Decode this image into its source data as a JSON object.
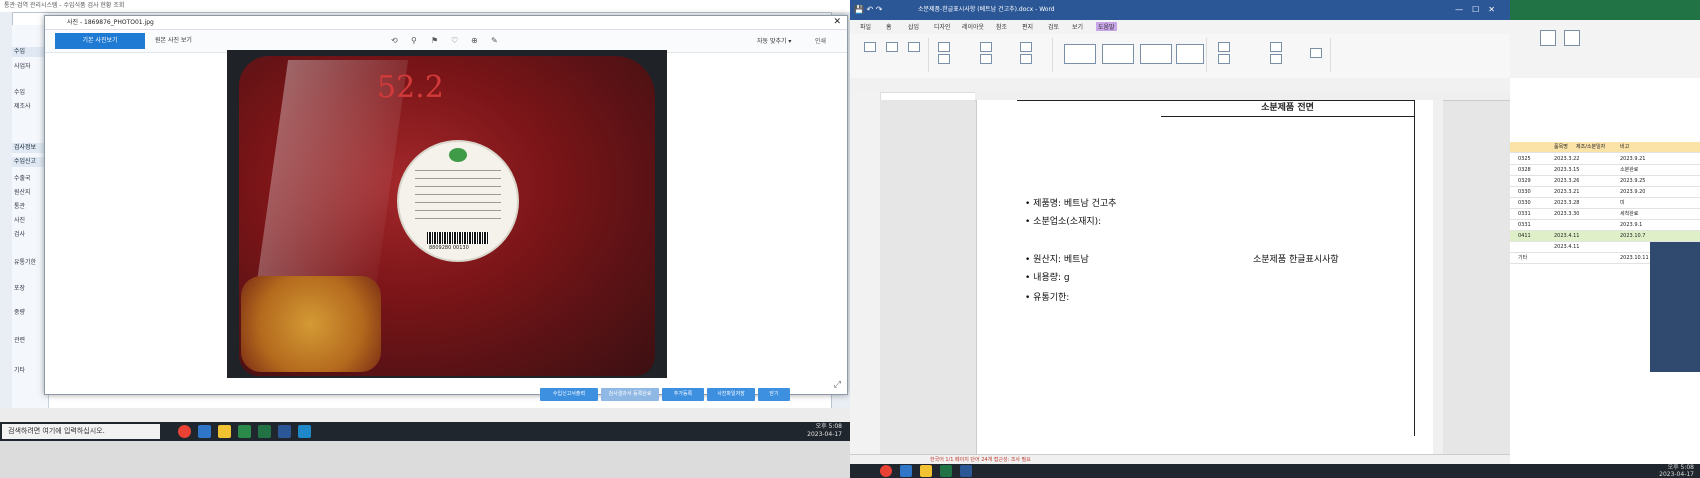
{
  "left_window": {
    "bg_title": "통관·검역 관리시스템 - 수입식품 검사 현황 조회",
    "viewer_title": "사진 - 1869876_PHOTO01.jpg",
    "tabs": [
      "기본 사진보기",
      "원본 사진 보기"
    ],
    "toolbar_icons": [
      "rotate-left-icon",
      "zoom-out-icon",
      "pin-icon",
      "heart-icon",
      "zoom-in-icon",
      "pencil-icon"
    ],
    "zoom_label": "자동 맞추기 ▾",
    "print_label": "인쇄",
    "sidebar": {
      "head1": "수입",
      "head2": "검사정보",
      "head3": "수입신고",
      "items": [
        "사업자",
        "수입",
        "제조사",
        "수출국",
        "원산지",
        "통관",
        "사진",
        "검사",
        "유통기한",
        "포장",
        "중량",
        "관련",
        "기타"
      ]
    },
    "actions": [
      "수입신고서출력",
      "검사결과서 등록완료",
      "추가등록",
      "사진파일저장",
      "닫기"
    ],
    "image_label_text": {
      "scribble": "52.2",
      "barcode": "8809280 00130"
    }
  },
  "left_taskbar": {
    "search_placeholder": "검색하려면 여기에 입력하십시오.",
    "clock_time": "오후 5:08",
    "clock_date": "2023-04-17"
  },
  "word": {
    "title": "소분제품-한글표시사항 (베트남 건고추).docx - Word",
    "ribbon_tabs": [
      "파일",
      "홈",
      "삽입",
      "디자인",
      "레이아웃",
      "참조",
      "편지",
      "검토",
      "보기",
      "도움말"
    ],
    "active_tab": "레이아웃",
    "doc": {
      "header": "소분제품 전면",
      "lines": [
        "• 제품명: 베트남 건고추",
        "• 소분업소(소재지):",
        "• 원산지: 베트남",
        "• 내용량: g",
        "• 유통기한:"
      ],
      "right_title": "소분제품 한글표시사항"
    },
    "status": "한국어  1/1 페이지  단어 24개  접근성: 조사 필요"
  },
  "excel": {
    "header_cells": [
      "품목명",
      "제조/소분일자",
      "비고"
    ],
    "rows": [
      [
        "0325",
        "2023.3.22",
        "2023.9.21"
      ],
      [
        "0328",
        "2023.3.15",
        "소분완료"
      ],
      [
        "0329",
        "2023.3.26",
        "2023.9.25"
      ],
      [
        "0330",
        "2023.3.21",
        "2023.9.20"
      ],
      [
        "0330",
        "2023.3.28",
        "미"
      ],
      [
        "0331",
        "2023.3.30",
        "세척완료"
      ],
      [
        "0331",
        "",
        "2023.9.1"
      ],
      [
        "0411",
        "2023.4.11",
        "2023.10.7"
      ],
      [
        "",
        "2023.4.11",
        ""
      ],
      [
        "기타",
        "",
        "2023.10.11"
      ]
    ]
  },
  "right_taskbar": {
    "clock_time": "오후 5:08",
    "clock_date": "2023-04-17"
  },
  "colors": {
    "accent": "#1f7ad3",
    "word_blue": "#2b5797",
    "excel_green": "#217346"
  }
}
